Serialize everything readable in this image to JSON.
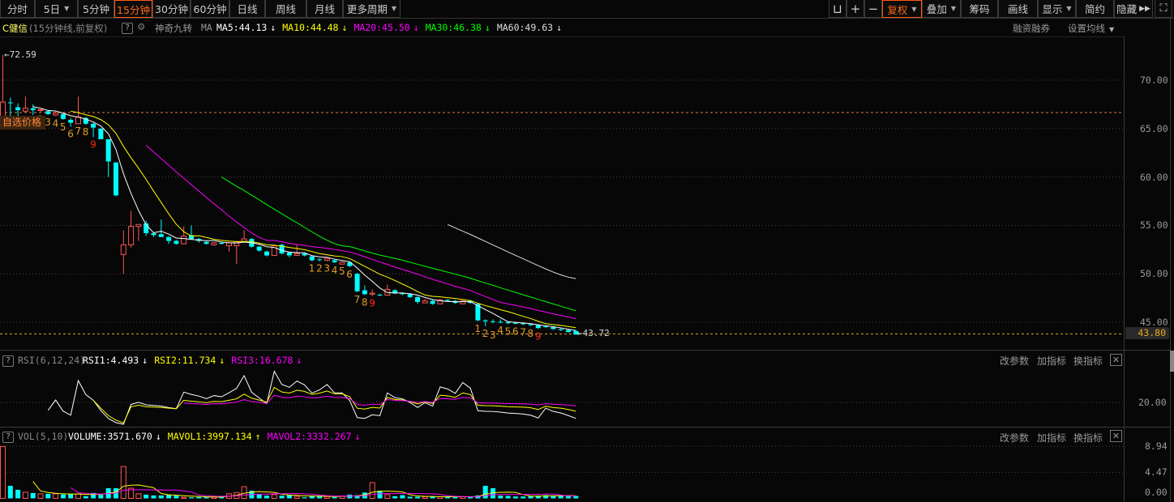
{
  "toolbar": {
    "periods": [
      {
        "label": "分时",
        "dropdown": false,
        "active": false
      },
      {
        "label": "5日",
        "dropdown": true,
        "active": false
      },
      {
        "label": "5分钟",
        "dropdown": false,
        "active": false
      },
      {
        "label": "15分钟",
        "dropdown": false,
        "active": true
      },
      {
        "label": "30分钟",
        "dropdown": false,
        "active": false
      },
      {
        "label": "60分钟",
        "dropdown": false,
        "active": false
      },
      {
        "label": "日线",
        "dropdown": false,
        "active": false
      },
      {
        "label": "周线",
        "dropdown": false,
        "active": false
      },
      {
        "label": "月线",
        "dropdown": false,
        "active": false
      },
      {
        "label": "更多周期",
        "dropdown": true,
        "active": false
      }
    ],
    "right_icons": [
      "unlock-icon",
      "plus-icon",
      "minus-icon"
    ],
    "right_buttons": [
      {
        "label": "复权",
        "dropdown": true,
        "active": true
      },
      {
        "label": "叠加",
        "dropdown": true,
        "active": false
      },
      {
        "label": "筹码",
        "dropdown": false,
        "active": false
      },
      {
        "label": "画线",
        "dropdown": false,
        "active": false
      },
      {
        "label": "显示",
        "dropdown": true,
        "active": false
      },
      {
        "label": "简约",
        "dropdown": false,
        "active": false
      },
      {
        "label": "隐藏",
        "dropdown": false,
        "active": false
      }
    ],
    "hide_icon": "double-play-icon",
    "fullscreen_icon": "fullscreen-icon"
  },
  "info": {
    "stock_name": "C健信",
    "period_desc": "(15分钟线,前复权)",
    "help": "?",
    "nine_turn": "神奇九转",
    "ma_label": "MA",
    "ma": [
      {
        "text": "MA5:44.13",
        "arrow": "↓",
        "color": "#ffffff"
      },
      {
        "text": "MA10:44.48",
        "arrow": "↓",
        "color": "#ffff00"
      },
      {
        "text": "MA20:45.50",
        "arrow": "↓",
        "color": "#ff00ff"
      },
      {
        "text": "MA30:46.38",
        "arrow": "↓",
        "color": "#00ff00"
      },
      {
        "text": "MA60:49.63",
        "arrow": "↓",
        "color": "#dddddd"
      }
    ],
    "margin_trading": "融资融券",
    "set_ma": "设置均线"
  },
  "colors": {
    "up": "#ff5555",
    "down": "#00ffff",
    "accent": "#ff6a1a",
    "price_line": "#e6a817"
  },
  "price_axis": {
    "ticks": [
      "70.00",
      "65.00",
      "60.00",
      "55.00",
      "50.00",
      "45.00"
    ],
    "current": "43.80"
  },
  "annotations": {
    "high": "72.59",
    "low": "43.72",
    "custom_price_label": "自选价格",
    "custom_price": 66.66
  },
  "rsi_panel": {
    "help": "?",
    "name": "RSI(6,12,24)",
    "values": [
      {
        "text": "RSI1:4.493",
        "arrow": "↓",
        "color": "#ffffff"
      },
      {
        "text": "RSI2:11.734",
        "arrow": "↓",
        "color": "#ffff00"
      },
      {
        "text": "RSI3:16.678",
        "arrow": "↓",
        "color": "#ff00ff"
      }
    ],
    "axis": [
      "20.00"
    ],
    "buttons": [
      "改参数",
      "加指标",
      "换指标"
    ]
  },
  "vol_panel": {
    "help": "?",
    "name": "VOL(5,10)",
    "values": [
      {
        "text": "VOLUME:3571.670",
        "arrow": "↓",
        "color": "#ffffff"
      },
      {
        "text": "MAVOL1:3997.134",
        "arrow": "↑",
        "color": "#ffff00"
      },
      {
        "text": "MAVOL2:3332.267",
        "arrow": "↓",
        "color": "#ff00ff"
      }
    ],
    "axis": [
      "8.94",
      "4.47",
      "0.00"
    ],
    "buttons": [
      "改参数",
      "加指标",
      "换指标"
    ]
  },
  "chart_data": {
    "type": "candlestick",
    "ylim": [
      43,
      73
    ],
    "grid": true,
    "ohlc": [
      [
        64.98,
        72.59,
        64.98,
        67.74
      ],
      [
        67.7,
        68.2,
        66.3,
        67.68
      ],
      [
        67.2,
        67.6,
        66.3,
        66.9
      ],
      [
        66.8,
        68.3,
        66.7,
        67.1
      ],
      [
        67.1,
        67.5,
        66.4,
        66.9
      ],
      [
        66.9,
        67.0,
        66.7,
        66.95
      ],
      [
        66.8,
        66.9,
        66.4,
        66.5
      ],
      [
        66.4,
        66.7,
        66.3,
        66.6
      ],
      [
        66.5,
        66.6,
        65.9,
        66.0
      ],
      [
        65.9,
        66.1,
        65.2,
        65.6
      ],
      [
        65.5,
        68.3,
        65.5,
        66.2
      ],
      [
        66.1,
        66.2,
        65.4,
        65.5
      ],
      [
        65.5,
        65.6,
        64.1,
        65.1
      ],
      [
        65.0,
        65.0,
        63.9,
        63.9
      ],
      [
        63.9,
        63.9,
        60.0,
        61.6
      ],
      [
        61.5,
        61.5,
        58.0,
        58.1
      ],
      [
        52.0,
        54.5,
        50.0,
        53.0
      ],
      [
        53.0,
        56.5,
        52.7,
        54.9
      ],
      [
        54.9,
        55.1,
        53.4,
        55.1
      ],
      [
        55.2,
        55.5,
        53.9,
        54.2
      ],
      [
        54.2,
        54.3,
        53.8,
        54.0
      ],
      [
        54.1,
        55.6,
        53.8,
        53.8
      ],
      [
        53.8,
        53.9,
        53.1,
        53.4
      ],
      [
        53.4,
        53.5,
        53.0,
        53.1
      ],
      [
        53.1,
        54.9,
        53.1,
        53.9
      ],
      [
        54.0,
        55.0,
        53.5,
        53.6
      ],
      [
        53.6,
        53.7,
        53.2,
        53.4
      ],
      [
        53.3,
        53.4,
        53.0,
        53.1
      ],
      [
        53.0,
        53.3,
        52.9,
        53.2
      ],
      [
        53.2,
        53.3,
        53.0,
        53.1
      ],
      [
        52.9,
        53.3,
        52.3,
        53.2
      ],
      [
        52.9,
        53.4,
        51.0,
        53.3
      ],
      [
        53.3,
        54.5,
        53.2,
        53.6
      ],
      [
        53.6,
        53.7,
        52.7,
        52.8
      ],
      [
        52.8,
        52.9,
        52.3,
        52.4
      ],
      [
        52.3,
        52.4,
        51.8,
        51.9
      ],
      [
        51.9,
        53.0,
        51.9,
        52.9
      ],
      [
        53.0,
        53.1,
        52.0,
        52.1
      ],
      [
        52.2,
        52.3,
        51.7,
        51.9
      ],
      [
        51.9,
        53.0,
        51.9,
        52.1
      ],
      [
        52.1,
        52.2,
        51.8,
        51.9
      ],
      [
        51.8,
        51.9,
        51.3,
        51.4
      ],
      [
        51.5,
        51.6,
        51.3,
        51.48
      ],
      [
        51.4,
        51.7,
        51.3,
        51.6
      ],
      [
        51.4,
        51.5,
        51.1,
        51.2
      ],
      [
        51.0,
        51.3,
        51.0,
        51.2
      ],
      [
        51.2,
        51.3,
        50.7,
        50.8
      ],
      [
        50.0,
        50.1,
        48.1,
        48.2
      ],
      [
        48.3,
        48.8,
        47.8,
        47.9
      ],
      [
        47.9,
        48.4,
        47.7,
        48.0
      ],
      [
        47.85,
        47.95,
        47.7,
        47.8
      ],
      [
        47.8,
        48.9,
        47.8,
        48.4
      ],
      [
        48.3,
        48.4,
        47.9,
        48.0
      ],
      [
        48.0,
        48.1,
        47.8,
        47.9
      ],
      [
        47.9,
        48.0,
        47.5,
        47.6
      ],
      [
        47.6,
        47.7,
        46.9,
        47.1
      ],
      [
        47.0,
        47.4,
        47.0,
        47.2
      ],
      [
        47.2,
        47.3,
        46.8,
        46.9
      ],
      [
        46.9,
        47.4,
        46.9,
        47.3
      ],
      [
        47.3,
        47.4,
        47.1,
        47.2
      ],
      [
        47.2,
        47.3,
        46.9,
        47.0
      ],
      [
        46.9,
        47.3,
        46.9,
        47.2
      ],
      [
        47.2,
        47.3,
        46.9,
        47.0
      ],
      [
        46.9,
        47.0,
        45.1,
        45.2
      ],
      [
        45.2,
        45.3,
        44.6,
        45.1
      ],
      [
        45.1,
        45.3,
        44.9,
        45.08
      ],
      [
        45.05,
        45.3,
        44.9,
        45.0
      ],
      [
        45.0,
        45.1,
        44.8,
        44.9
      ],
      [
        44.95,
        45.0,
        44.8,
        44.85
      ],
      [
        44.9,
        45.0,
        44.7,
        44.8
      ],
      [
        44.8,
        44.9,
        44.6,
        44.7
      ],
      [
        44.7,
        44.8,
        44.3,
        44.4
      ],
      [
        44.6,
        44.7,
        44.4,
        44.5
      ],
      [
        44.5,
        44.6,
        44.2,
        44.3
      ],
      [
        44.3,
        44.4,
        44.1,
        44.2
      ],
      [
        44.2,
        44.3,
        43.9,
        44.0
      ],
      [
        44.1,
        44.2,
        43.72,
        43.72
      ]
    ],
    "volume": [
      8.9,
      2.15,
      1.47,
      1.05,
      0.92,
      0.78,
      0.78,
      0.78,
      0.69,
      0.69,
      0.78,
      0.37,
      0.92,
      0.6,
      1.74,
      1.74,
      5.46,
      1.74,
      0.78,
      0.64,
      0.5,
      0.5,
      0.6,
      0.46,
      0.18,
      0.18,
      0.23,
      0.23,
      0.32,
      0.28,
      0.78,
      1.0,
      2.0,
      1.3,
      0.73,
      0.46,
      0.64,
      0.46,
      0.55,
      0.37,
      0.18,
      0.46,
      0.37,
      0.32,
      0.23,
      0.41,
      0.64,
      0.55,
      1.0,
      2.7,
      1.3,
      0.64,
      0.37,
      0.55,
      0.28,
      0.28,
      0.28,
      0.28,
      0.28,
      0.28,
      0.28,
      0.28,
      0.23,
      0.5,
      2.15,
      1.74,
      0.46,
      0.41,
      0.32,
      0.32,
      0.41,
      0.46,
      0.55,
      0.46,
      0.46,
      0.41,
      0.41
    ],
    "nine_turn": [
      {
        "i": 4,
        "n": "1"
      },
      {
        "i": 5,
        "n": "2"
      },
      {
        "i": 6,
        "n": "3"
      },
      {
        "i": 7,
        "n": "4"
      },
      {
        "i": 8,
        "n": "5"
      },
      {
        "i": 9,
        "n": "6"
      },
      {
        "i": 10,
        "n": "7"
      },
      {
        "i": 11,
        "n": "8"
      },
      {
        "i": 12,
        "n": "9"
      },
      {
        "i": 41,
        "n": "1"
      },
      {
        "i": 42,
        "n": "2"
      },
      {
        "i": 43,
        "n": "3"
      },
      {
        "i": 44,
        "n": "4"
      },
      {
        "i": 45,
        "n": "5"
      },
      {
        "i": 46,
        "n": "6"
      },
      {
        "i": 47,
        "n": "7"
      },
      {
        "i": 48,
        "n": "8"
      },
      {
        "i": 49,
        "n": "9"
      },
      {
        "i": 63,
        "n": "1"
      },
      {
        "i": 64,
        "n": "2"
      },
      {
        "i": 65,
        "n": "3"
      },
      {
        "i": 66,
        "n": "4"
      },
      {
        "i": 67,
        "n": "5"
      },
      {
        "i": 68,
        "n": "6"
      },
      {
        "i": 69,
        "n": "7"
      },
      {
        "i": 70,
        "n": "8"
      },
      {
        "i": 71,
        "n": "9"
      }
    ]
  }
}
